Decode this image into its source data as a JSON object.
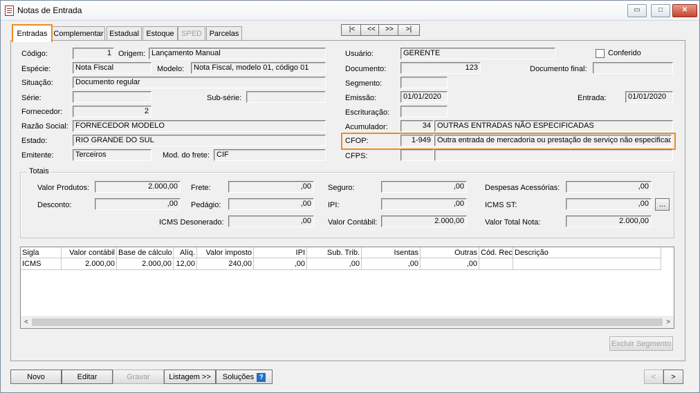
{
  "window": {
    "title": "Notas de Entrada",
    "icon": "document-icon",
    "min": "▭",
    "max": "□",
    "close": "✕"
  },
  "tabs": [
    {
      "label": "Entradas"
    },
    {
      "label": "Complementar"
    },
    {
      "label": "Estadual"
    },
    {
      "label": "Estoque"
    },
    {
      "label": "SPED"
    },
    {
      "label": "Parcelas"
    }
  ],
  "nav": {
    "first": "|<",
    "prev": "<<",
    "next": ">>",
    "last": ">|"
  },
  "form": {
    "codigo": {
      "label": "Código:",
      "value": "1"
    },
    "origem": {
      "label": "Origem:",
      "value": "Lançamento Manual"
    },
    "especie": {
      "label": "Espécie:",
      "value": "Nota Fiscal"
    },
    "modelo": {
      "label": "Modelo:",
      "value": "Nota Fiscal, modelo 01, código 01"
    },
    "situacao": {
      "label": "Situação:",
      "value": "Documento regular"
    },
    "serie": {
      "label": "Série:",
      "value": ""
    },
    "subserie": {
      "label": "Sub-série:",
      "value": ""
    },
    "fornecedor": {
      "label": "Fornecedor:",
      "value": "2"
    },
    "razao": {
      "label": "Razão Social:",
      "value": "FORNECEDOR MODELO"
    },
    "estado": {
      "label": "Estado:",
      "value": "RIO GRANDE DO SUL"
    },
    "emitente": {
      "label": "Emitente:",
      "value": "Terceiros"
    },
    "modfrete": {
      "label": "Mod. do frete:",
      "value": "CIF"
    },
    "usuario": {
      "label": "Usuário:",
      "value": "GERENTE"
    },
    "conferido": {
      "label": "Conferido"
    },
    "documento": {
      "label": "Documento:",
      "value": "123"
    },
    "docfinal": {
      "label": "Documento final:",
      "value": ""
    },
    "segmento": {
      "label": "Segmento:",
      "value": ""
    },
    "emissao": {
      "label": "Emissão:",
      "value": "01/01/2020"
    },
    "entrada": {
      "label": "Entrada:",
      "value": "01/01/2020"
    },
    "escrituracao": {
      "label": "Escrituração:",
      "value": ""
    },
    "acumulador": {
      "label": "Acumulador:",
      "code": "34",
      "desc": "OUTRAS ENTRADAS NÃO ESPECIFICADAS"
    },
    "cfop": {
      "label": "CFOP:",
      "code": "1-949",
      "desc": "Outra entrada de mercadoria ou prestação de serviço não especificada"
    },
    "cfps": {
      "label": "CFPS:",
      "code": "",
      "desc": ""
    }
  },
  "totais": {
    "title": "Totais",
    "valor_produtos": {
      "label": "Valor Produtos:",
      "value": "2.000,00"
    },
    "frete": {
      "label": "Frete:",
      "value": ",00"
    },
    "seguro": {
      "label": "Seguro:",
      "value": ",00"
    },
    "despesas": {
      "label": "Despesas Acessórias:",
      "value": ",00"
    },
    "desconto": {
      "label": "Desconto:",
      "value": ",00"
    },
    "pedagio": {
      "label": "Pedágio:",
      "value": ",00"
    },
    "ipi": {
      "label": "IPI:",
      "value": ",00"
    },
    "icms_st": {
      "label": "ICMS ST:",
      "value": ",00",
      "btn": "..."
    },
    "icms_desonerado": {
      "label": "ICMS Desonerado:",
      "value": ",00"
    },
    "valor_contabil": {
      "label": "Valor Contábil:",
      "value": "2.000,00"
    },
    "valor_total_nota": {
      "label": "Valor Total Nota:",
      "value": "2.000,00"
    }
  },
  "grid": {
    "headers": [
      "Sigla",
      "Valor contábil",
      "Base de cálculo",
      "Alíq.",
      "Valor imposto",
      "IPI",
      "Sub. Trib.",
      "Isentas",
      "Outras",
      "Cód. Rec.",
      "Descrição"
    ],
    "rows": [
      [
        "ICMS",
        "2.000,00",
        "2.000,00",
        "12,00",
        "240,00",
        ",00",
        ",00",
        ",00",
        ",00",
        "",
        ""
      ]
    ],
    "scroll_left": "<",
    "scroll_right": ">"
  },
  "buttons": {
    "excluir_segmento": "Excluir Segmento",
    "novo": "Novo",
    "editar": "Editar",
    "gravar": "Gravar",
    "listagem": "Listagem >>",
    "solucoes": "Soluções",
    "help": "?",
    "prev": "<",
    "next": ">"
  },
  "colors": {
    "highlight": "#f08a1c",
    "help": "#1f6fc5"
  }
}
